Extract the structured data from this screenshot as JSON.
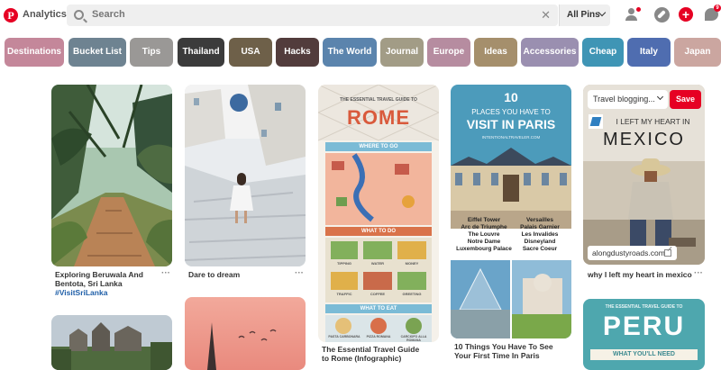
{
  "header": {
    "logo": "P",
    "app_name": "Analytics",
    "search_placeholder": "Search",
    "scope": "All Pins",
    "chat_badge": "9"
  },
  "categories": [
    {
      "label": "Destinations",
      "color": "#c4879a"
    },
    {
      "label": "Bucket List",
      "color": "#6e8391"
    },
    {
      "label": "Tips",
      "color": "#9a9896"
    },
    {
      "label": "Thailand",
      "color": "#3b3b3b"
    },
    {
      "label": "USA",
      "color": "#6e6049"
    },
    {
      "label": "Hacks",
      "color": "#523c3c"
    },
    {
      "label": "The World",
      "color": "#5b84ad"
    },
    {
      "label": "Journal",
      "color": "#a29c86"
    },
    {
      "label": "Europe",
      "color": "#b68ca0"
    },
    {
      "label": "Ideas",
      "color": "#a58f6c"
    },
    {
      "label": "Accessories",
      "color": "#9a8fb0"
    },
    {
      "label": "Cheap",
      "color": "#3f95b5"
    },
    {
      "label": "Italy",
      "color": "#4f6db0"
    },
    {
      "label": "Japan",
      "color": "#cba6a0"
    }
  ],
  "pins": {
    "sri_lanka": {
      "caption": "Exploring Beruwala And Bentota, Sri Lanka",
      "tag": "#VisitSriLanka"
    },
    "dream": {
      "caption": "Dare to dream"
    },
    "rome": {
      "caption": "The Essential Travel Guide to Rome (Infographic)",
      "kicker": "THE ESSENTIAL TRAVEL GUIDE TO",
      "title": "ROME",
      "section1": "WHERE TO GO",
      "section2": "WHAT TO DO",
      "section3": "WHAT TO EAT",
      "do_items": [
        "TIPPING",
        "WATER",
        "MONEY",
        "TRAFFIC",
        "COFFEE",
        "GREETING"
      ],
      "eat_items": [
        "PASTA CARBONARA",
        "PIZZA ROMANA",
        "CARCIOFO ALLA ROMANA"
      ]
    },
    "paris": {
      "caption": "10 Things You Have To See Your First Time In Paris",
      "number": "10",
      "line1": "PLACES YOU HAVE TO",
      "line2": "VISIT IN PARIS",
      "site": "INTENTIONALTRAVELER.COM",
      "places_left": [
        "Eiffel Tower",
        "Arc de Triumphe",
        "The Louvre",
        "Notre Dame",
        "Luxembourg Palace"
      ],
      "places_right": [
        "Versailles",
        "Palais Garnier",
        "Les Invalides",
        "Disneyland",
        "Sacre Coeur"
      ]
    },
    "mexico": {
      "caption": "why I left my heart in mexico",
      "board": "Travel blogging...",
      "save": "Save",
      "line1": "I LEFT MY HEART IN",
      "line2": "MEXICO",
      "source": "alongdustyroads.com"
    },
    "peru": {
      "kicker": "THE ESSENTIAL TRAVEL GUIDE TO",
      "title": "PERU",
      "section": "WHAT YOU'LL NEED"
    }
  },
  "more": "···"
}
